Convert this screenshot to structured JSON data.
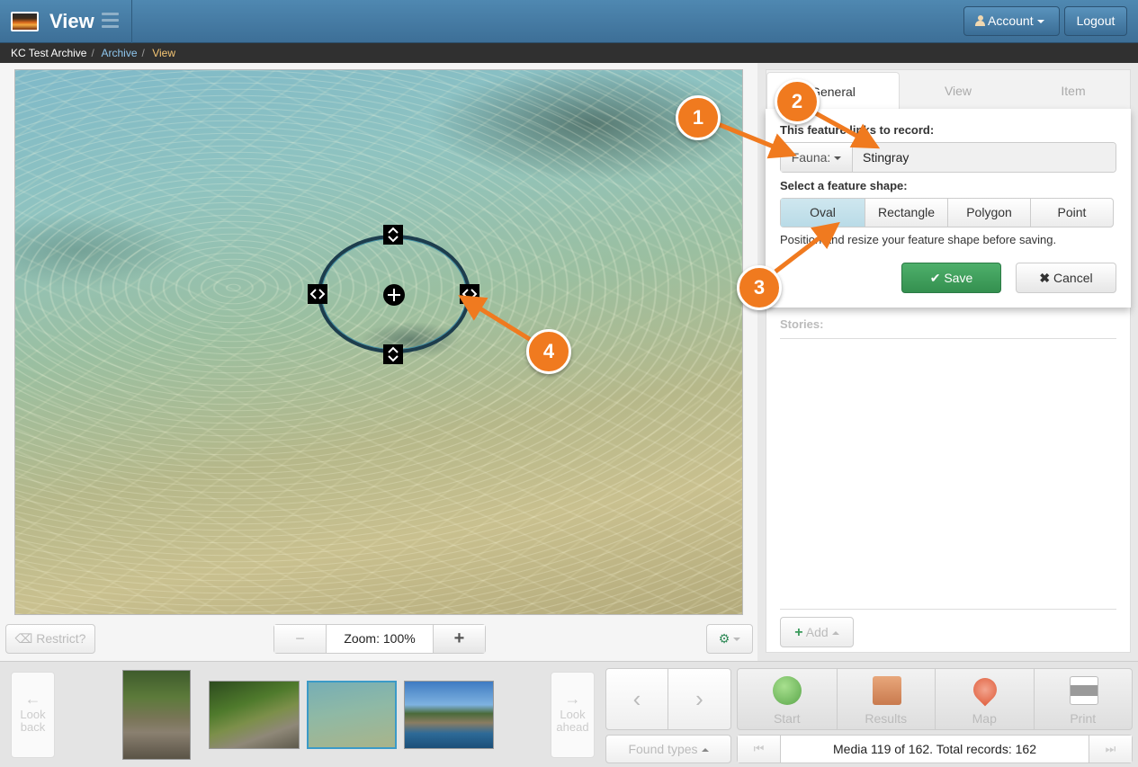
{
  "header": {
    "title": "View",
    "account_label": "Account",
    "logout_label": "Logout"
  },
  "breadcrumb": {
    "items": [
      "KC Test Archive",
      "Archive",
      "View"
    ]
  },
  "viewer": {
    "restrict_label": "Restrict?",
    "zoom_label": "Zoom: 100%",
    "zoom_out": "−",
    "zoom_in": "+"
  },
  "panel": {
    "tabs": [
      "General",
      "View",
      "Item"
    ],
    "active_tab": "General",
    "links_label": "This feature links to record:",
    "record_type": "Fauna:",
    "record_value": "Stingray",
    "shape_label": "Select a feature shape:",
    "shapes": [
      "Oval",
      "Rectangle",
      "Polygon",
      "Point"
    ],
    "selected_shape": "Oval",
    "hint": "Position and resize your feature shape before saving.",
    "save_label": "Save",
    "cancel_label": "Cancel",
    "stories_label": "Stories:",
    "add_label": "Add"
  },
  "filmstrip": {
    "look_back": [
      "Look",
      "back"
    ],
    "look_ahead": [
      "Look",
      "ahead"
    ]
  },
  "actions": {
    "found_types_label": "Found types",
    "items": [
      "Start",
      "Results",
      "Map",
      "Print"
    ],
    "pager_status": "Media 119 of 162. Total records: 162"
  },
  "callouts": [
    "1",
    "2",
    "3",
    "4"
  ],
  "colors": {
    "header": "#4a82ad",
    "callout": "#f07a1f",
    "save": "#3c9b59",
    "selected_shape": "#c5e1eb"
  }
}
